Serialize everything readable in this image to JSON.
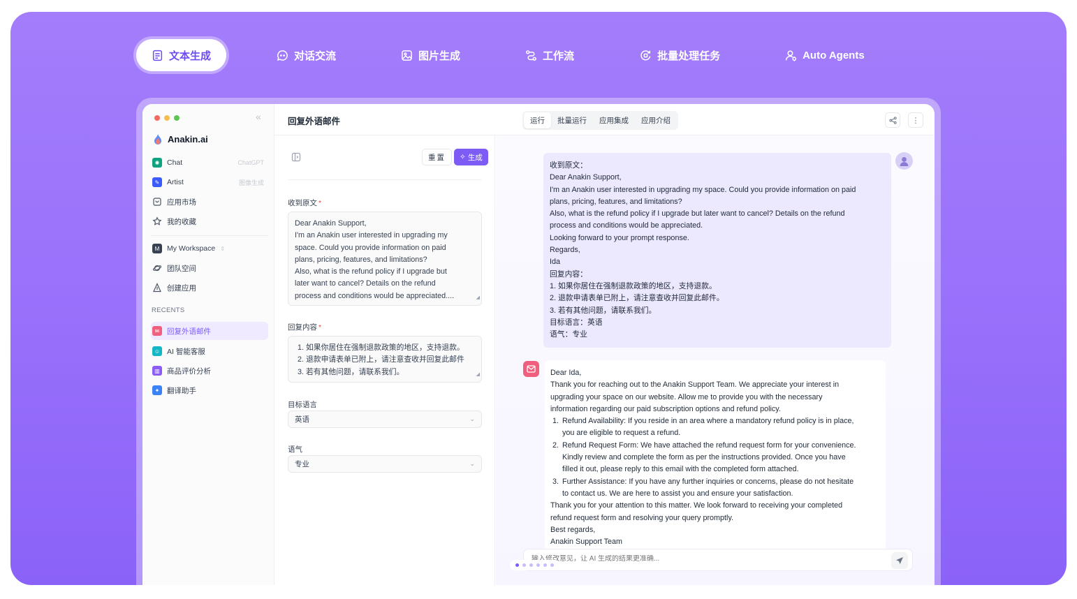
{
  "colors": {
    "accent": "#7c5cf5",
    "background_gradient_top": "#a37dfb",
    "background_gradient_bottom": "#8b62f8"
  },
  "top_nav": [
    {
      "label": "文本生成",
      "icon": "document-icon",
      "active": true
    },
    {
      "label": "对话交流",
      "icon": "chat-bubble-icon",
      "active": false
    },
    {
      "label": "图片生成",
      "icon": "image-icon",
      "active": false
    },
    {
      "label": "工作流",
      "icon": "workflow-icon",
      "active": false
    },
    {
      "label": "批量处理任务",
      "icon": "batch-icon",
      "active": false
    },
    {
      "label": "Auto Agents",
      "icon": "agents-icon",
      "active": false
    }
  ],
  "sidebar": {
    "brand": "Anakin.ai",
    "items": [
      {
        "label": "Chat",
        "hint": "ChatGPT"
      },
      {
        "label": "Artist",
        "hint": "图像生成"
      },
      {
        "label": "应用市场"
      },
      {
        "label": "我的收藏"
      },
      {
        "label": "My Workspace"
      },
      {
        "label": "团队空间"
      },
      {
        "label": "创建应用"
      }
    ],
    "recents_label": "RECENTS",
    "recents": [
      {
        "label": "回复外语邮件",
        "active": true
      },
      {
        "label": "AI 智能客服"
      },
      {
        "label": "商品评价分析"
      },
      {
        "label": "翻译助手"
      }
    ]
  },
  "header": {
    "title": "回复外语邮件",
    "tabs": [
      "运行",
      "批量运行",
      "应用集成",
      "应用介绍"
    ]
  },
  "form": {
    "reset_label": "重置",
    "generate_label": "生成",
    "field1_label": "收到原文",
    "field1_lines": [
      "Dear Anakin Support,",
      "I'm an Anakin user interested in upgrading my",
      "space. Could you provide information on paid",
      "plans, pricing, features, and limitations?",
      "Also, what is the refund policy if I upgrade but",
      "later want to cancel? Details on the refund",
      "process and conditions would be appreciated...."
    ],
    "field2_label": "回复内容",
    "field2_lines": [
      "1. 如果你居住在强制退款政策的地区，支持退款。",
      "2. 退款申请表单已附上，请注意查收并回复此邮件",
      "3. 若有其他问题，请联系我们。"
    ],
    "field3_label": "目标语言",
    "field3_value": "英语",
    "field4_label": "语气",
    "field4_value": "专业"
  },
  "output": {
    "user_lines": [
      "收到原文：",
      "Dear Anakin Support,",
      "I'm an Anakin user interested in upgrading my space. Could you provide information on paid",
      "plans, pricing, features, and limitations?",
      "Also, what is the refund policy if I upgrade but later want to cancel? Details on the refund",
      "process and conditions would be appreciated.",
      "Looking forward to your prompt response.",
      "Regards,",
      "Ida",
      "回复内容：",
      "1. 如果你居住在强制退款政策的地区，支持退款。",
      "2. 退款申请表单已附上，请注意查收并回复此邮件。",
      "3. 若有其他问题，请联系我们。",
      "目标语言：英语",
      "语气：专业"
    ],
    "ai_intro": [
      "Dear Ida,",
      "Thank you for reaching out to the Anakin Support Team. We appreciate your interest in",
      "upgrading your space on our website. Allow me to provide you with the necessary",
      "information regarding our paid subscription options and refund policy."
    ],
    "ai_list": [
      {
        "num": "1.",
        "lines": [
          "Refund Availability: If you reside in an area where a mandatory refund policy is in place,",
          "you are eligible to request a refund."
        ]
      },
      {
        "num": "2.",
        "lines": [
          "Refund Request Form: We have attached the refund request form for your convenience.",
          "Kindly review and complete the form as per the instructions provided. Once you have",
          "filled it out, please reply to this email with the completed form attached."
        ]
      },
      {
        "num": "3.",
        "lines": [
          "Further Assistance: If you have any further inquiries or concerns, please do not hesitate",
          "to contact us. We are here to assist you and ensure your satisfaction."
        ]
      }
    ],
    "ai_outro": [
      "Thank you for your attention to this matter. We look forward to receiving your completed",
      "refund request form and resolving your query promptly.",
      "Best regards,",
      "Anakin Support Team"
    ],
    "input_placeholder": "输入修改意见，让 AI 生成的结果更准确..."
  }
}
